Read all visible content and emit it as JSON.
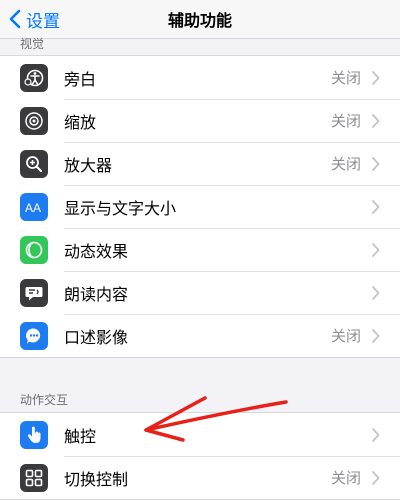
{
  "nav": {
    "back_label": "设置",
    "title": "辅助功能"
  },
  "sections": {
    "vision_header": "视觉",
    "interaction_header": "动作交互"
  },
  "vision_items": [
    {
      "label": "旁白",
      "value": "关闭",
      "icon": "voiceover-icon",
      "color": "#3a3a3c"
    },
    {
      "label": "缩放",
      "value": "关闭",
      "icon": "zoom-icon",
      "color": "#3a3a3c"
    },
    {
      "label": "放大器",
      "value": "关闭",
      "icon": "magnifier-icon",
      "color": "#3a3a3c"
    },
    {
      "label": "显示与文字大小",
      "value": "",
      "icon": "text-size-icon",
      "color": "#1e7cf2"
    },
    {
      "label": "动态效果",
      "value": "",
      "icon": "motion-icon",
      "color": "#33c759"
    },
    {
      "label": "朗读内容",
      "value": "",
      "icon": "spoken-content-icon",
      "color": "#3a3a3c"
    },
    {
      "label": "口述影像",
      "value": "关闭",
      "icon": "audio-description-icon",
      "color": "#1e7cf2"
    }
  ],
  "interaction_items": [
    {
      "label": "触控",
      "value": "",
      "icon": "touch-icon",
      "color": "#1e7cf2"
    },
    {
      "label": "切换控制",
      "value": "关闭",
      "icon": "switch-control-icon",
      "color": "#3a3a3c"
    }
  ],
  "colors": {
    "accent": "#007aff",
    "annotation": "#e8201a"
  }
}
